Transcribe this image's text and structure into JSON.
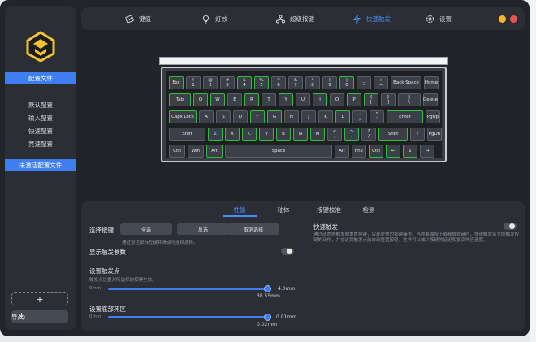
{
  "sidebar": {
    "section_profiles": "配置文件",
    "profiles": [
      "默认配置",
      "输入配置",
      "快速配置",
      "竞速配置"
    ],
    "section_inactive": "未激活配置文件",
    "new_symbol": "+",
    "import_label": "导入"
  },
  "nav": {
    "items": [
      {
        "label": "键值",
        "icon": "keycap-icon"
      },
      {
        "label": "灯效",
        "icon": "bulb-icon"
      },
      {
        "label": "超级按键",
        "icon": "nodes-icon"
      },
      {
        "label": "快速触发",
        "icon": "lightning-icon"
      },
      {
        "label": "设置",
        "icon": "gear-icon"
      }
    ],
    "active": "快速触发"
  },
  "keyboard": {
    "rows": [
      [
        "Esc",
        "!\n1",
        "@\n2",
        "#\n3",
        "$\n4",
        "%\n5",
        "^\n6",
        "&\n7",
        "*\n8",
        "(\n9",
        ")\n0",
        "_\n-",
        "+\n=",
        "Back Space",
        "Home"
      ],
      [
        "Tab",
        "Q",
        "W",
        "E",
        "R",
        "T",
        "Y",
        "U",
        "I",
        "O",
        "P",
        "{\n[",
        "}\n]",
        "|\n\\",
        "Delete"
      ],
      [
        "Caps Lock",
        "A",
        "S",
        "D",
        "F",
        "G",
        "H",
        "J",
        "K",
        "L",
        ":\n;",
        "\"\n'",
        "Enter",
        "PgUp"
      ],
      [
        "Shift",
        "Z",
        "X",
        "C",
        "V",
        "B",
        "N",
        "M",
        "<\n,",
        ">\n.",
        "?\n/",
        "Shift",
        "↑",
        "PgDn"
      ],
      [
        "Ctrl",
        "Win",
        "Alt",
        "Space",
        "Alt",
        "Fn2",
        "Ctrl",
        "←",
        "↓",
        "→"
      ]
    ]
  },
  "panel": {
    "tabs": [
      "性能",
      "轴体",
      "按键校准",
      "检测"
    ],
    "active_tab": "性能",
    "select_keys_label": "选择按键",
    "select_all": "全选",
    "invert": "反选",
    "cancel_select": "取消选择",
    "select_hint": "通过按住鼠标左键并滑动可连续选择。",
    "show_trigger_label": "显示触发参数",
    "trigger_point_label": "设置触发点",
    "trigger_point_hint": "触发点设置对所选择的按键生效。",
    "trigger_min": "0mm",
    "trigger_max": "4.0mm",
    "trigger_value": "38.55mm",
    "trigger_fraction": 0.99,
    "deadzone_label": "设置底部死区",
    "deadzone_min": "0mm",
    "deadzone_max": "0.01mm",
    "deadzone_value": "0.02mm",
    "deadzone_fraction": 0.99,
    "rapid_trigger_title": "快速触发",
    "rapid_trigger_desc": "通过动态地触发和重置按键，实现更快的按键操作。当你着面按下或释放按键时，快速触发会立即触发按键的动作，并在达到触发点前自动重置按键。这样可以减少按键的延迟和提高响应速度。"
  }
}
